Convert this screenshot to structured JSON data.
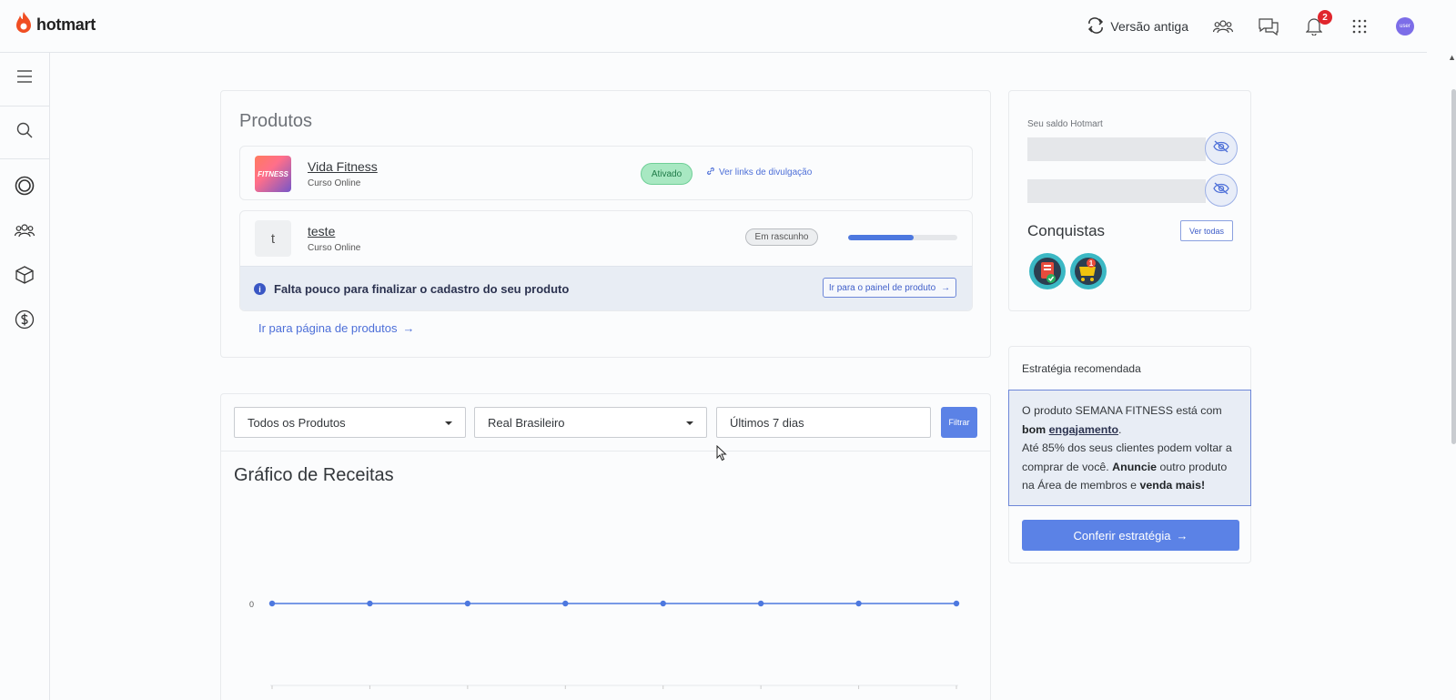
{
  "brand": {
    "name": "hotmart",
    "color": "#f04e23"
  },
  "topbar": {
    "old_version_label": "Versão antiga",
    "notifications_count": "2",
    "avatar_text": "user"
  },
  "sidebar": {
    "items": [
      {
        "icon": "menu-icon"
      },
      {
        "icon": "search-icon"
      },
      {
        "icon": "target-icon"
      },
      {
        "icon": "users-icon"
      },
      {
        "icon": "box-icon"
      },
      {
        "icon": "dollar-icon"
      }
    ]
  },
  "products": {
    "title": "Produtos",
    "items": [
      {
        "name": "Vida Fitness",
        "type": "Curso Online",
        "thumb_text": "FITNESS",
        "status": "Ativado",
        "link_label": "Ver links de divulgação"
      },
      {
        "name": "teste",
        "type": "Curso Online",
        "thumb_text": "t",
        "status": "Em rascunho",
        "progress": 0.6
      }
    ],
    "notice_text": "Falta pouco para finalizar o cadastro do seu produto",
    "notice_button": "Ir para o painel de produto",
    "products_link": "Ir para página de produtos"
  },
  "revenue": {
    "filters": {
      "product": "Todos os Produtos",
      "currency": "Real Brasileiro",
      "period": "Últimos 7 dias",
      "filter_button": "Filtrar"
    },
    "title": "Gráfico de Receitas"
  },
  "chart_data": {
    "type": "line",
    "title": "Gráfico de Receitas",
    "xlabel": "",
    "ylabel": "",
    "y_ticks": [
      "0"
    ],
    "series": [
      {
        "values": [
          0,
          0,
          0,
          0,
          0,
          0,
          0,
          0
        ]
      }
    ],
    "color": "#4d78df"
  },
  "balance": {
    "label": "Seu saldo Hotmart",
    "achievements_title": "Conquistas",
    "see_all": "Ver todas"
  },
  "strategy": {
    "title": "Estratégia recomendada",
    "text_1": "O produto SEMANA FITNESS está com ",
    "bold_1": "bom ",
    "underline_1": "engajamento",
    "text_2": ".",
    "text_3": "Até 85% dos seus clientes podem voltar a comprar de você. ",
    "bold_2": "Anuncie",
    "text_4": " outro produto na Área de membros e ",
    "bold_3": "venda mais!",
    "button": "Conferir estratégia"
  },
  "colors": {
    "accent": "#5b82e6",
    "active_green": "#a8e8c2",
    "notice_bg": "#e8edf4"
  }
}
